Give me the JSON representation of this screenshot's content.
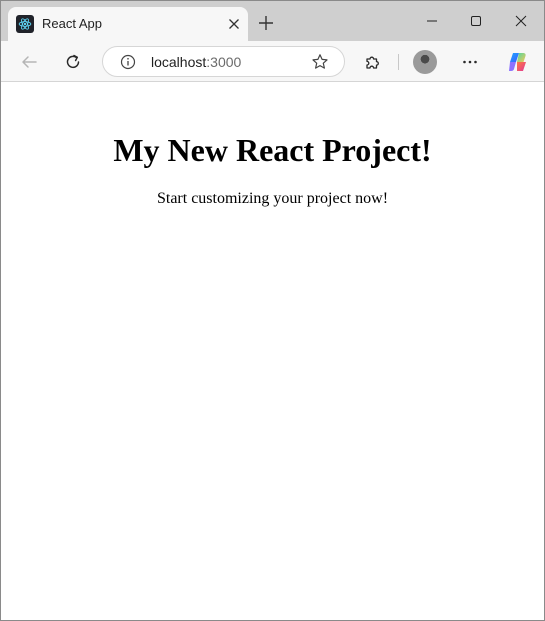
{
  "tab": {
    "title": "React App"
  },
  "address_bar": {
    "host": "localhost",
    "port": ":3000"
  },
  "page": {
    "heading": "My New React Project!",
    "subheading": "Start customizing your project now!"
  },
  "colors": {
    "tabstrip_bg": "#cfcfcf",
    "toolbar_bg": "#f7f7f7",
    "react_logo": "#61dafb",
    "page_bg": "#ffffff"
  },
  "icons": {
    "favicon": "react-logo-icon",
    "tab_close": "close-icon",
    "new_tab": "plus-icon",
    "back": "arrow-left-icon",
    "reload": "reload-icon",
    "site_info": "info-icon",
    "favorite": "star-icon",
    "extensions": "puzzle-icon",
    "more": "ellipsis-icon",
    "copilot": "copilot-icon"
  }
}
